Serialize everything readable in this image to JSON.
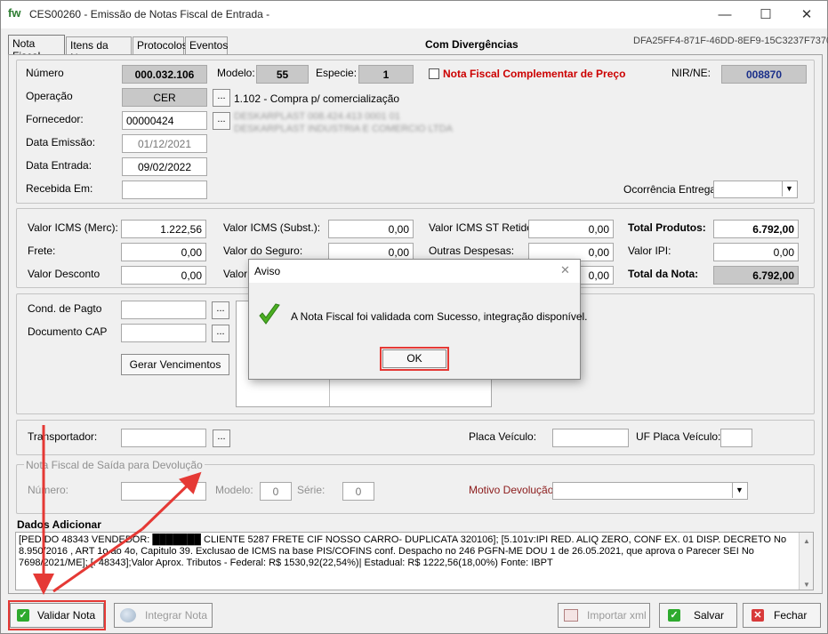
{
  "window": {
    "logo": "fw",
    "title": "CES00260 - Emissão de  Notas  Fiscal de Entrada -",
    "minimize": "—",
    "maximize": "☐",
    "close": "✕"
  },
  "tabs": [
    {
      "label": "Nota Fiscal"
    },
    {
      "label": "Itens da Nota"
    },
    {
      "label": "Protocolos"
    },
    {
      "label": "Eventos"
    }
  ],
  "header": {
    "status": "Com Divergências",
    "key": "DFA25FF4-871F-46DD-8EF9-15C3237F7370"
  },
  "identification": {
    "numero_label": "Número",
    "numero_value": "000.032.106",
    "modelo_label": "Modelo:",
    "modelo_value": "55",
    "especie_label": "Especie:",
    "especie_value": "1",
    "complementar_label": "Nota Fiscal Complementar de Preço",
    "nir_label": "NIR/NE:",
    "nir_value": "008870",
    "operacao_label": "Operação",
    "operacao_value": "CER",
    "operacao_desc": "1.102 - Compra p/ comercialização",
    "fornecedor_label": "Fornecedor:",
    "fornecedor_value": "00000424",
    "fornecedor_line1": "DESKARPLAST          008.424.413    0001    01",
    "fornecedor_line2": "DESKARPLAST INDUSTRIA E COMERCIO LTDA",
    "data_emissao_label": "Data Emissão:",
    "data_emissao_value": "01/12/2021",
    "data_entrada_label": "Data Entrada:",
    "data_entrada_value": "09/02/2022",
    "recebida_label": "Recebida Em:",
    "recebida_value": "",
    "ocorrencia_label": "Ocorrência Entrega:",
    "ocorrencia_value": ""
  },
  "values": {
    "icms_merc_label": "Valor ICMS (Merc):",
    "icms_merc_value": "1.222,56",
    "frete_label": "Frete:",
    "frete_value": "0,00",
    "desconto_label": "Valor Desconto",
    "desconto_value": "0,00",
    "icms_subst_label": "Valor  ICMS (Subst.):",
    "icms_subst_value": "0,00",
    "seguro_label": "Valor do Seguro:",
    "seguro_value": "0,00",
    "valor_partial_label": "Valor",
    "icms_st_label": "Valor ICMS ST Retido:",
    "icms_st_value": "0,00",
    "outras_label": "Outras Despesas:",
    "outras_value": "0,00",
    "third_value": "0,00",
    "total_prod_label": "Total Produtos:",
    "total_prod_value": "6.792,00",
    "ipi_label": "Valor IPI:",
    "ipi_value": "0,00",
    "total_nota_label": "Total da Nota:",
    "total_nota_value": "6.792,00"
  },
  "payment": {
    "cond_label": "Cond. de Pagto",
    "doc_label": "Documento CAP",
    "gerar_button": "Gerar Vencimentos",
    "ellipsis": "..."
  },
  "transport": {
    "transportador_label": "Transportador:",
    "placa_label": "Placa Veículo:",
    "uf_placa_label": "UF Placa Veículo:"
  },
  "devolucao": {
    "group_label": "Nota Fiscal de Saída para Devolução",
    "numero_label": "Número:",
    "modelo_label": "Modelo:",
    "modelo_value": "0",
    "serie_label": "Série:",
    "serie_value": "0",
    "motivo_label": "Motivo Devolução"
  },
  "dados": {
    "label": "Dados Adicionar",
    "text": "[PEDIDO 48343 VENDEDOR: ███████ CLIENTE 5287 FRETE CIF NOSSO CARRO- DUPLICATA 320106];  [5.101v:IPI RED. ALIQ ZERO, CONF EX. 01 DISP. DECRETO No 8.950/2016 , ART 1o ao 4o, Capitulo 39. Exclusao de ICMS na base PIS/COFINS conf. Despacho no 246 PGFN-ME DOU 1 de 26.05.2021, que aprova o Parecer SEI No 7698/2021/ME];  [. 48343];Valor Aprox. Tributos -  Federal: R$ 1530,92(22,54%)| Estadual: R$ 1222,56(18,00%) Fonte: IBPT"
  },
  "dialog": {
    "title": "Aviso",
    "close": "✕",
    "message": "A Nota Fiscal foi validada com Sucesso, integração disponível.",
    "ok": "OK"
  },
  "bottom": {
    "validar": "Validar Nota",
    "integrar": "Integrar Nota",
    "importar": "Importar xml",
    "salvar": "Salvar",
    "fechar": "Fechar"
  },
  "colors": {
    "highlight_red": "#e53935",
    "nir_blue": "#1a2f8a",
    "complementar_red": "#cc0000",
    "ok_green": "#2eaa2e"
  }
}
